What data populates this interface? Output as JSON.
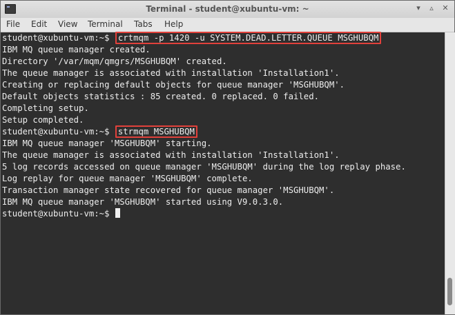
{
  "window": {
    "title": "Terminal - student@xubuntu-vm: ~"
  },
  "menu": [
    "File",
    "Edit",
    "View",
    "Terminal",
    "Tabs",
    "Help"
  ],
  "terminal": {
    "prompt": "student@xubuntu-vm:~$ ",
    "cmd1": "crtmqm -p 1420 -u SYSTEM.DEAD.LETTER.QUEUE MSGHUBQM",
    "out1": [
      "IBM MQ queue manager created.",
      "Directory '/var/mqm/qmgrs/MSGHUBQM' created.",
      "The queue manager is associated with installation 'Installation1'.",
      "Creating or replacing default objects for queue manager 'MSGHUBQM'.",
      "Default objects statistics : 85 created. 0 replaced. 0 failed.",
      "Completing setup.",
      "Setup completed."
    ],
    "cmd2": "strmqm MSGHUBQM",
    "out2": [
      "IBM MQ queue manager 'MSGHUBQM' starting.",
      "The queue manager is associated with installation 'Installation1'.",
      "5 log records accessed on queue manager 'MSGHUBQM' during the log replay phase.",
      "Log replay for queue manager 'MSGHUBQM' complete.",
      "Transaction manager state recovered for queue manager 'MSGHUBQM'.",
      "IBM MQ queue manager 'MSGHUBQM' started using V9.0.3.0."
    ]
  },
  "icons": {
    "app": "terminal-icon",
    "minimize": "minimize-icon",
    "maximize": "maximize-icon",
    "close": "close-icon"
  },
  "colors": {
    "highlight_border": "#e2413b",
    "terminal_bg": "#2e2e2e",
    "terminal_fg": "#ededed"
  }
}
